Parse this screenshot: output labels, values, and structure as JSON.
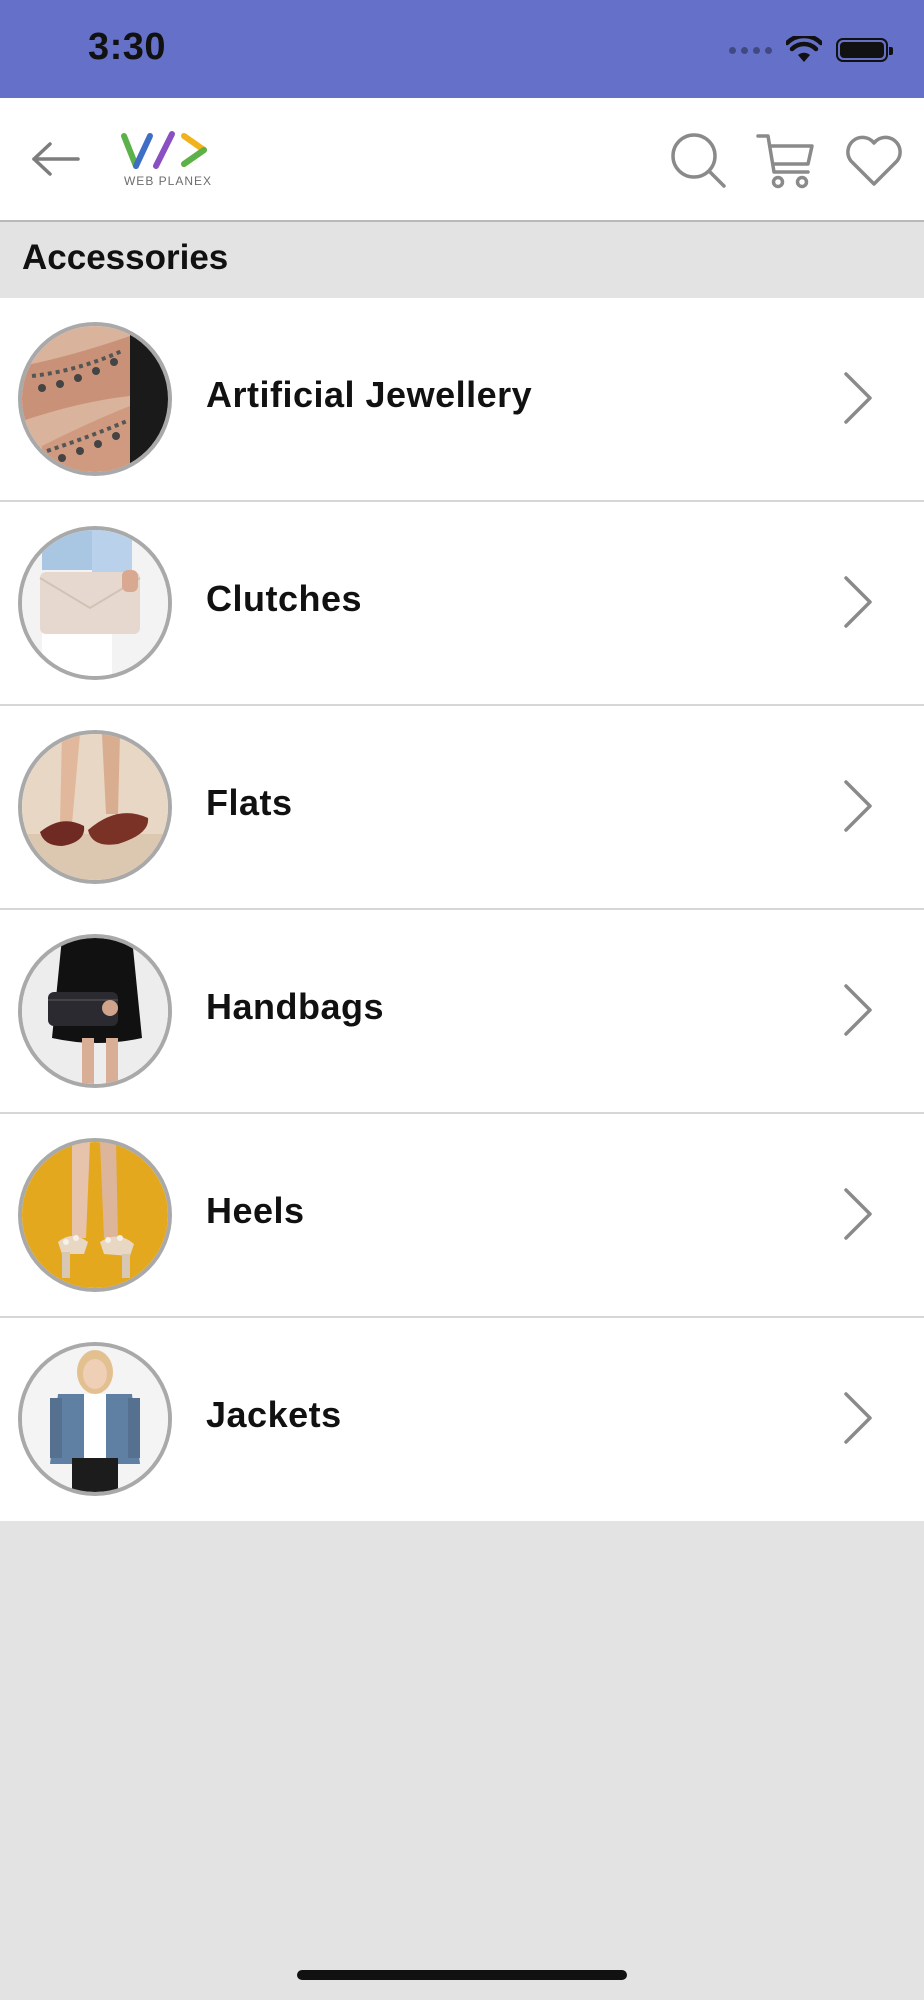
{
  "status_bar": {
    "time": "3:30"
  },
  "header": {
    "logo_text": "WEB PLANEX",
    "icons": [
      "back-arrow-icon",
      "search-icon",
      "cart-icon",
      "heart-icon"
    ]
  },
  "section": {
    "title": "Accessories"
  },
  "categories": [
    {
      "label": "Artificial Jewellery",
      "thumb": "anklet-photo"
    },
    {
      "label": "Clutches",
      "thumb": "clutch-photo"
    },
    {
      "label": "Flats",
      "thumb": "flats-photo"
    },
    {
      "label": "Handbags",
      "thumb": "handbag-photo"
    },
    {
      "label": "Heels",
      "thumb": "heels-photo"
    },
    {
      "label": "Jackets",
      "thumb": "jacket-photo"
    }
  ],
  "colors": {
    "status_bar": "#6571c9",
    "background": "#e3e3e3",
    "row_background": "#ffffff",
    "divider": "#d6d6d6",
    "icon_gray": "#8a8a8a",
    "logo_green": "#5bb14a",
    "logo_blue": "#3f6fc4",
    "logo_purple": "#8a4fc0",
    "logo_yellow": "#f2b21b"
  }
}
